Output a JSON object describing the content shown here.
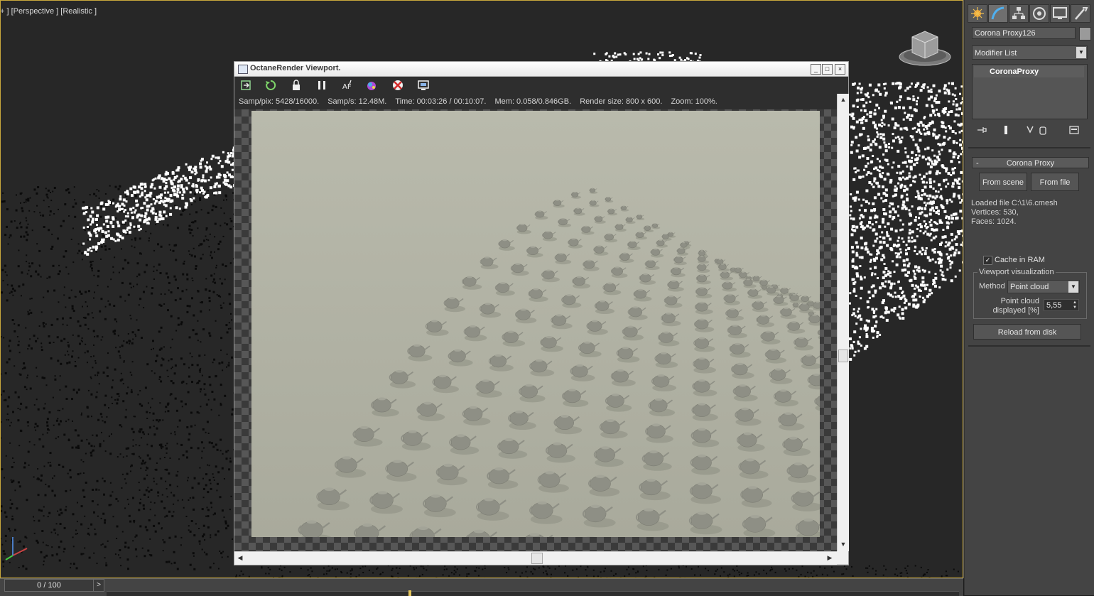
{
  "viewport": {
    "label": "+ ] [Perspective ] [Realistic ]"
  },
  "timeline": {
    "position": "0 / 100",
    "next_glyph": ">"
  },
  "octane": {
    "title": "OctaneRender Viewport.",
    "window_buttons": {
      "minimize": "_",
      "maximize": "□",
      "close": "×"
    },
    "toolbar_icons": [
      "send-scene-icon",
      "restart-icon",
      "lock-icon",
      "pause-icon",
      "focus-picker-icon",
      "material-picker-icon",
      "clear-picker-icon",
      "region-render-icon"
    ],
    "status": {
      "samp_pix": "Samp/pix: 5428/16000.",
      "samp_s": "Samp/s: 12.48M.",
      "time": "Time: 00:03:26 / 00:10:07.",
      "mem": "Mem: 0.058/0.846GB.",
      "render_size": "Render size: 800 x 600.",
      "zoom": "Zoom: 100%."
    },
    "render_background": "#b3b4a6"
  },
  "command_panel": {
    "tabs": [
      "create-tab-icon",
      "modify-tab-icon",
      "hierarchy-tab-icon",
      "motion-tab-icon",
      "display-tab-icon",
      "utilities-tab-icon"
    ],
    "active_tab": "modify-tab-icon",
    "object_name": "Corona Proxy126",
    "modifier_list": "Modifier List",
    "stack_item": "CoronaProxy",
    "rollout": {
      "title": "Corona Proxy",
      "collapse_glyph": "-",
      "from_scene": "From scene",
      "from_file": "From file",
      "loaded_file": "Loaded file C:\\1\\6.cmesh",
      "vertices": "Vertices: 530,",
      "faces": "Faces: 1024.",
      "cache_in_ram": "Cache in RAM",
      "cache_checked": true,
      "viewport_visualization": "Viewport visualization",
      "method_label": "Method",
      "method_value": "Point cloud",
      "point_cloud_label_1": "Point cloud",
      "point_cloud_label_2": "displayed [%]",
      "point_cloud_value": "5,55",
      "reload": "Reload from disk"
    }
  },
  "colors": {
    "viewport_bg": "#272727",
    "viewport_border": "#c9a83c",
    "panel_bg": "#444444",
    "render_bg": "#b3b4a6",
    "teapot": "#8e8f85"
  }
}
